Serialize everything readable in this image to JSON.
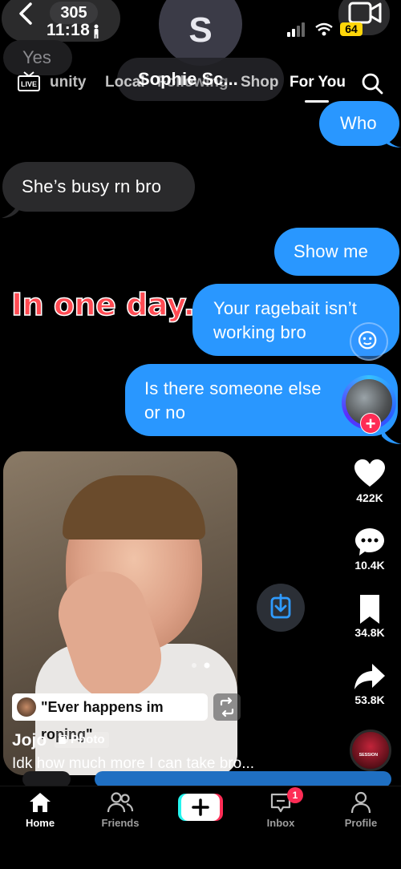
{
  "status_bar": {
    "time": "11:18",
    "battery": "64",
    "messages_badge": "305"
  },
  "imessage": {
    "contact_initial": "S",
    "contact_name": "Sophie Sc...",
    "partial_message": "Yes"
  },
  "tiktok_nav": {
    "live_label": "LIVE",
    "tabs": [
      {
        "label": "unity"
      },
      {
        "label": "Local"
      },
      {
        "label": "Following"
      },
      {
        "label": "Shop"
      },
      {
        "label": "For You"
      }
    ]
  },
  "messages": [
    {
      "text": "Who",
      "side": "right"
    },
    {
      "text": "She’s busy rn bro",
      "side": "left"
    },
    {
      "text": "Show me",
      "side": "right"
    },
    {
      "text": "Your ragebait isn’t working bro",
      "line1": "Your ragebait isn’t",
      "line2": "working bro",
      "side": "right"
    },
    {
      "text": "Is there someone else or no",
      "line1": "Is there someone else",
      "line2": "or no",
      "side": "right"
    }
  ],
  "overlay_text": "In one day.",
  "post": {
    "quote": "\"Ever happens im roping\"",
    "username": "Jojo",
    "tag": "Photo",
    "caption": "Idk how much more I can take bro..."
  },
  "actions": {
    "likes": "422K",
    "comments": "10.4K",
    "saves": "34.8K",
    "shares": "53.8K",
    "sound_label": "SESSION"
  },
  "bottom_nav": {
    "home": "Home",
    "friends": "Friends",
    "inbox": "Inbox",
    "inbox_badge": "1",
    "profile": "Profile"
  },
  "colors": {
    "imessage_blue": "#2997ff",
    "tiktok_red": "#fe2c55",
    "overlay_red": "#ff4a52"
  }
}
